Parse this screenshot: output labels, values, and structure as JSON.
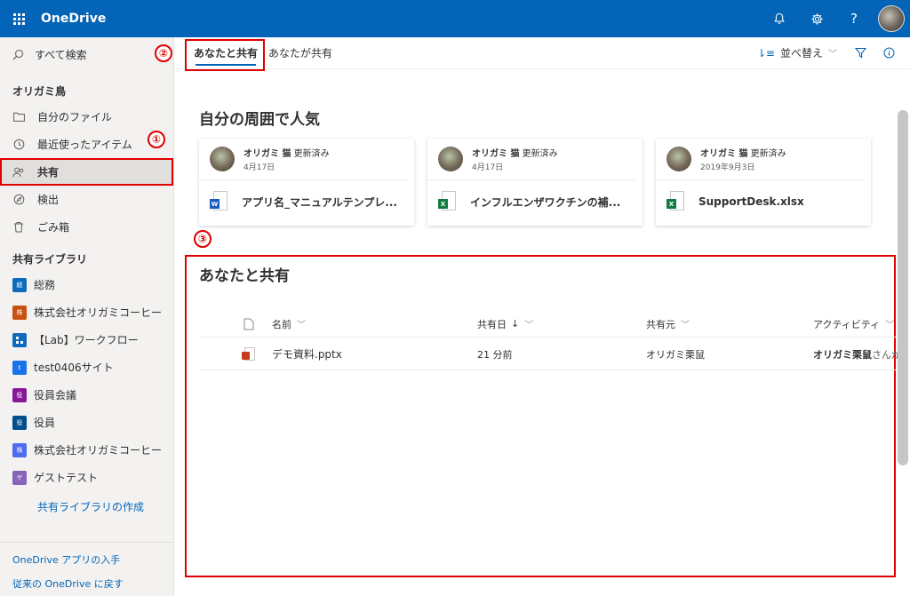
{
  "app": {
    "title": "OneDrive"
  },
  "topbar": {
    "icons": [
      "bell-icon",
      "gear-icon",
      "help-icon",
      "avatar"
    ]
  },
  "leftnav": {
    "search_label": "すべて検索",
    "owner_title": "オリガミ鳥",
    "items": [
      {
        "label": "自分のファイル",
        "icon": "folder-icon"
      },
      {
        "label": "最近使ったアイテム",
        "icon": "history-icon"
      },
      {
        "label": "共有",
        "icon": "people-icon",
        "active": true
      },
      {
        "label": "検出",
        "icon": "discover-icon"
      },
      {
        "label": "ごみ箱",
        "icon": "trash-icon"
      }
    ],
    "libraries_title": "共有ライブラリ",
    "libraries": [
      {
        "label": "総務",
        "badge": "総",
        "color": "#0f6cbd"
      },
      {
        "label": "株式会社オリガミコーヒー",
        "badge": "株",
        "color": "#ca5010"
      },
      {
        "label": "【Lab】ワークフロー",
        "badge": "",
        "color": "#0f6cbd"
      },
      {
        "label": "test0406サイト",
        "badge": "t",
        "color": "#1a73e8"
      },
      {
        "label": "役員会議",
        "badge": "役",
        "color": "#881798"
      },
      {
        "label": "役員",
        "badge": "役",
        "color": "#004e8c"
      },
      {
        "label": "株式会社オリガミコーヒー",
        "badge": "株",
        "color": "#4f6bed"
      },
      {
        "label": "ゲストテスト",
        "badge": "ゲ",
        "color": "#8764b8"
      }
    ],
    "create_library": "共有ライブラリの作成",
    "bottom_links": [
      "OneDrive アプリの入手",
      "従来の OneDrive に戻す"
    ]
  },
  "cmdbar": {
    "tabs": [
      {
        "label": "あなたと共有",
        "active": true
      },
      {
        "label": "あなたが共有",
        "active": false
      }
    ],
    "sort_label": "並べ替え"
  },
  "annotations": {
    "one": "①",
    "two": "②",
    "three": "③"
  },
  "popular": {
    "title": "自分の周囲で人気",
    "cards": [
      {
        "user": "オリガミ 猫",
        "action": "更新済み",
        "date": "4月17日",
        "file": "アプリ名_マニュアルテンプレ...",
        "type": "W",
        "color": "#185abd"
      },
      {
        "user": "オリガミ 猫",
        "action": "更新済み",
        "date": "4月17日",
        "file": "インフルエンザワクチンの補...",
        "type": "X",
        "color": "#107c41"
      },
      {
        "user": "オリガミ 猫",
        "action": "更新済み",
        "date": "2019年9月3日",
        "file": "SupportDesk.xlsx",
        "type": "X",
        "color": "#107c41"
      }
    ]
  },
  "shared_list": {
    "title": "あなたと共有",
    "columns": {
      "name": "名前",
      "shared_date": "共有日",
      "shared_by": "共有元",
      "activity": "アクティビティ"
    },
    "rows": [
      {
        "name": "デモ資料.pptx",
        "shared_date": "21 分前",
        "shared_by": "オリガミ栗鼠",
        "activity_user": "オリガミ栗鼠",
        "activity_rest": "さんが"
      }
    ]
  }
}
